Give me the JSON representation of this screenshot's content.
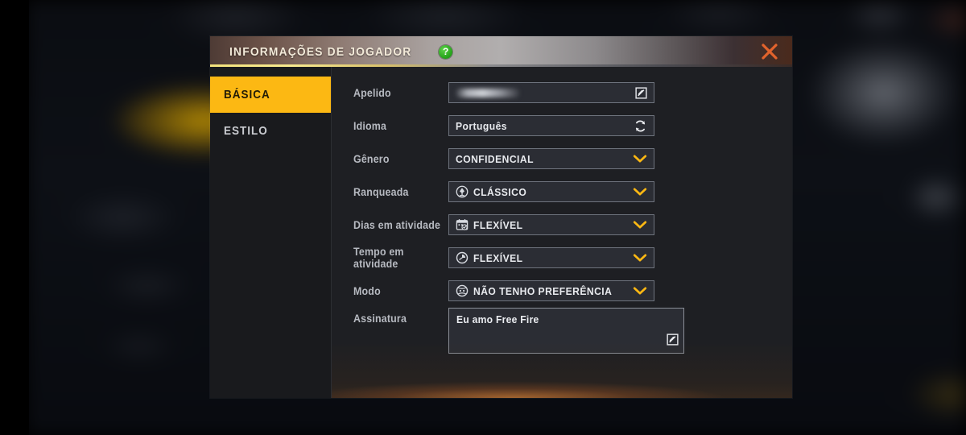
{
  "window": {
    "title": "INFORMAÇÕES DE JOGADOR",
    "help_icon_glyph": "?",
    "help_icon_name": "help-question-icon",
    "close_icon_name": "close-x-icon",
    "accent_yellow": "#fcb813",
    "close_orange": "#e2632c",
    "help_green": "#2aa81e"
  },
  "sidebar": {
    "items": [
      {
        "label": "BÁSICA",
        "active": true
      },
      {
        "label": "ESTILO",
        "active": false
      }
    ]
  },
  "form": {
    "rows": [
      {
        "label": "Apelido",
        "type": "text-censored",
        "value": "",
        "trailing_icon": "edit-pencil-icon"
      },
      {
        "label": "Idioma",
        "type": "text",
        "value": "Português",
        "trailing_icon": "refresh-sync-icon"
      },
      {
        "label": "Gênero",
        "type": "dropdown",
        "value": "CONFIDENCIAL",
        "trailing_icon": "chevron-down-icon"
      },
      {
        "label": "Ranqueada",
        "type": "dropdown",
        "value": "CLÁSSICO",
        "leading_icon": "rank-emblem-icon",
        "trailing_icon": "chevron-down-icon"
      },
      {
        "label": "Dias em atividade",
        "type": "dropdown",
        "value": "FLEXÍVEL",
        "leading_icon": "calendar-check-icon",
        "trailing_icon": "chevron-down-icon"
      },
      {
        "label": "Tempo em atividade",
        "type": "dropdown",
        "value": "FLEXÍVEL",
        "leading_icon": "clock-icon",
        "trailing_icon": "chevron-down-icon"
      },
      {
        "label": "Modo",
        "type": "dropdown",
        "value": "NÃO TENHO PREFERÊNCIA",
        "leading_icon": "game-mode-target-icon",
        "trailing_icon": "chevron-down-icon"
      }
    ],
    "signature": {
      "label": "Assinatura",
      "value": "Eu amo Free Fire",
      "edit_icon": "edit-pencil-icon"
    }
  },
  "annotation": {
    "arrow_name": "left-pointing-arrow-annotation",
    "color": "#fcb813",
    "points_to": "Apelido"
  }
}
